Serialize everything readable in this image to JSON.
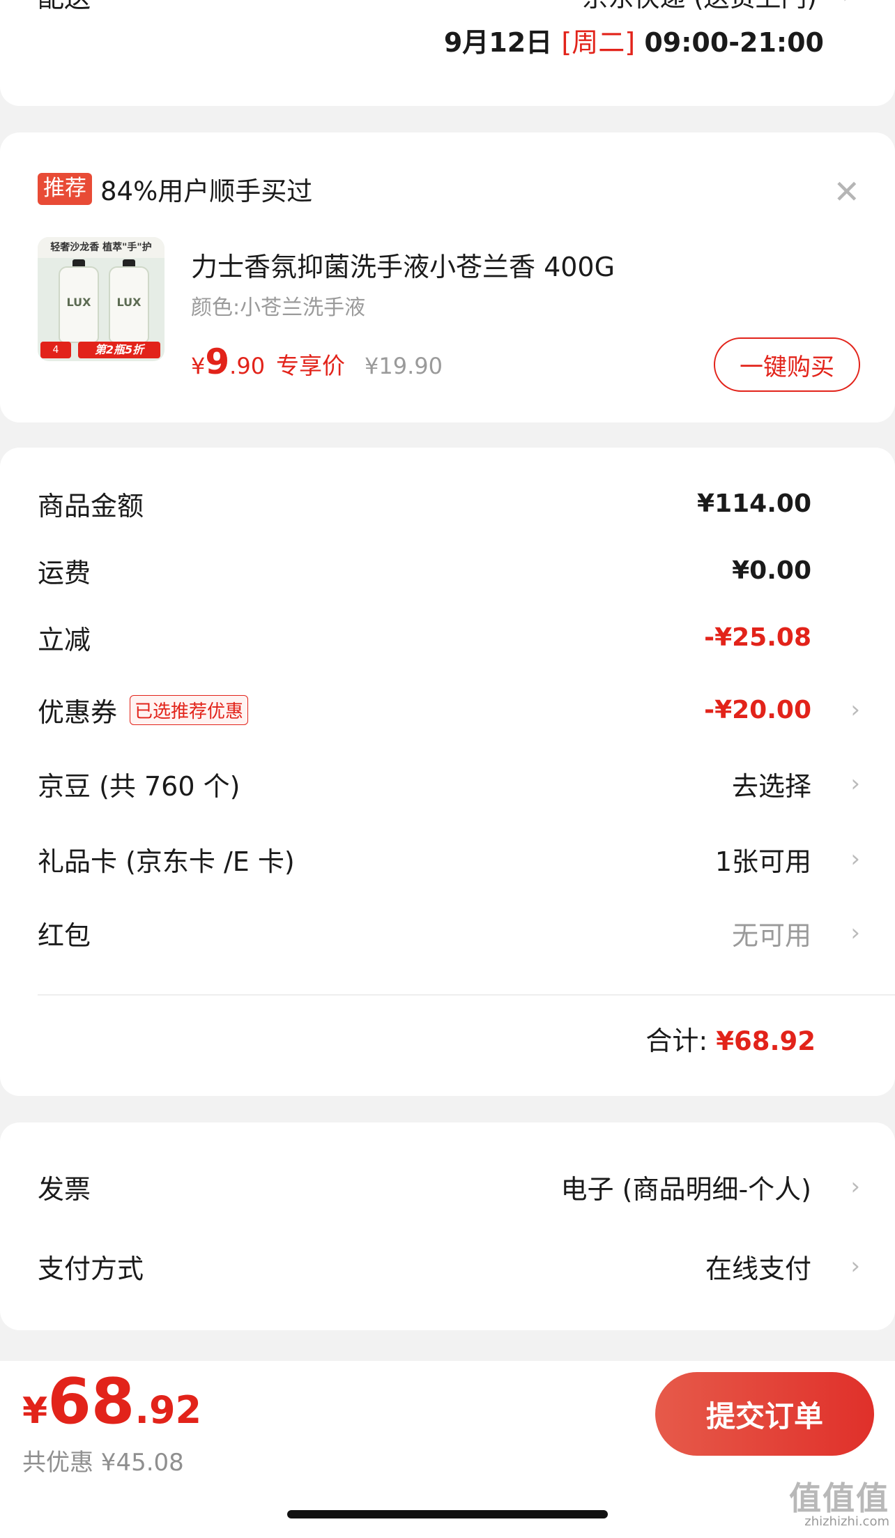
{
  "delivery": {
    "label": "配送",
    "method": "京东快递 (送货上门)",
    "date": "9月12日",
    "weekday": "[周二]",
    "time": "09:00-21:00"
  },
  "recommend": {
    "badge": "推荐",
    "headline": "84%用户顺手买过",
    "product": {
      "title": "力士香氛抑菌洗手液小苍兰香 400G",
      "variant": "颜色:小苍兰洗手液",
      "price_symbol": "¥",
      "price_int": "9",
      "price_dec": ".90",
      "price_tag": "专享价",
      "original_price": "¥19.90",
      "image_top_text": "轻奢沙龙香 植萃\"手\"护",
      "image_bottom_text": "第2瓶5折",
      "image_brand": "LUX",
      "image_corner": "4"
    },
    "buy_label": "一键购买"
  },
  "summary": {
    "rows": [
      {
        "label": "商品金额",
        "value": "¥114.00"
      },
      {
        "label": "运费",
        "value": "¥0.00"
      },
      {
        "label": "立减",
        "value": "-¥25.08"
      },
      {
        "label": "优惠券",
        "tag": "已选推荐优惠",
        "value": "-¥20.00"
      },
      {
        "label": "京豆 (共 760 个)",
        "value": "去选择"
      },
      {
        "label": "礼品卡 (京东卡 /E 卡)",
        "value": "1张可用"
      },
      {
        "label": "红包",
        "value": "无可用"
      }
    ],
    "total_label": "合计:",
    "total_value": "¥68.92"
  },
  "invoice": {
    "rows": [
      {
        "label": "发票",
        "value": "电子 (商品明细-个人)"
      },
      {
        "label": "支付方式",
        "value": "在线支付"
      }
    ]
  },
  "bottom": {
    "price_symbol": "¥",
    "price_int": "68",
    "price_dec": ".92",
    "saved": "共优惠 ¥45.08",
    "submit_label": "提交订单"
  },
  "watermark": {
    "logo": "值值值",
    "url": "zhizhizhi.com"
  },
  "colors": {
    "accent": "#e2231a",
    "background": "#f2f2f2"
  },
  "icons": {
    "close": "close-icon",
    "chevron": "chevron-right-icon"
  }
}
